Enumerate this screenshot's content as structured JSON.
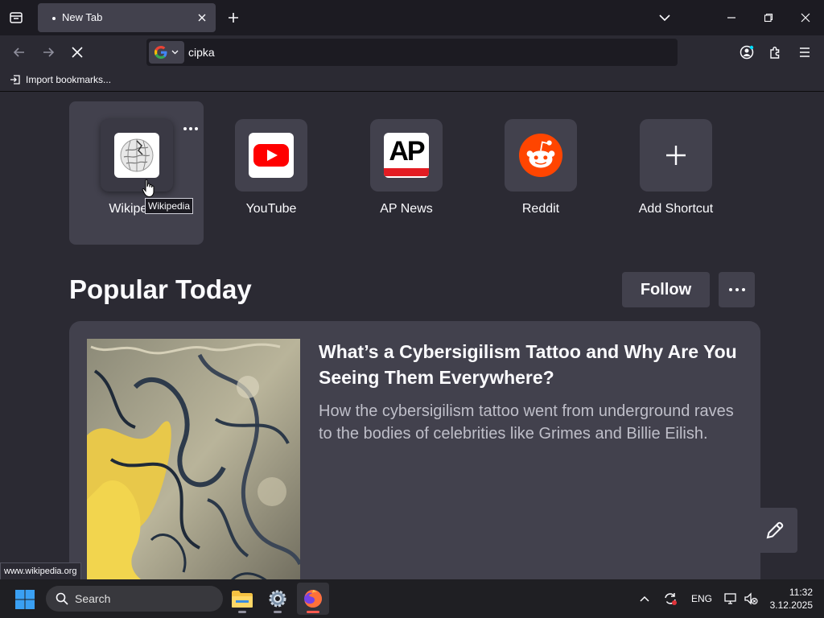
{
  "browser": {
    "tabs": [
      {
        "title": "New Tab",
        "active": true
      }
    ],
    "urlbar": {
      "value": "cipka",
      "engine_icon": "google-icon"
    },
    "bookmarks": {
      "import_label": "Import bookmarks..."
    },
    "status_url": "www.wikipedia.org"
  },
  "newtab": {
    "shortcuts": [
      {
        "label": "Wikipedia",
        "icon": "wikipedia-icon"
      },
      {
        "label": "YouTube",
        "icon": "youtube-icon"
      },
      {
        "label": "AP News",
        "icon": "ap-news-icon",
        "logo_text": "AP"
      },
      {
        "label": "Reddit",
        "icon": "reddit-icon"
      },
      {
        "label": "Add Shortcut",
        "icon": "plus-icon"
      }
    ],
    "tooltip": "Wikipedia",
    "section_title": "Popular Today",
    "follow_label": "Follow",
    "story": {
      "title": "What’s a Cybersigilism Tattoo and Why Are You Seeing Them Everywhere?",
      "excerpt": "How the cybersigilism tattoo went from underground raves to the bodies of celebrities like Grimes and Billie Eilish."
    }
  },
  "taskbar": {
    "search_label": "Search",
    "language": "ENG",
    "time": "11:32",
    "date": "3.12.2025"
  },
  "colors": {
    "chrome_dark": "#1c1b22",
    "surface": "#2b2a33",
    "card": "#42414d",
    "youtube_red": "#ff0000",
    "reddit_orange": "#ff4500",
    "ap_red": "#e31c23"
  }
}
